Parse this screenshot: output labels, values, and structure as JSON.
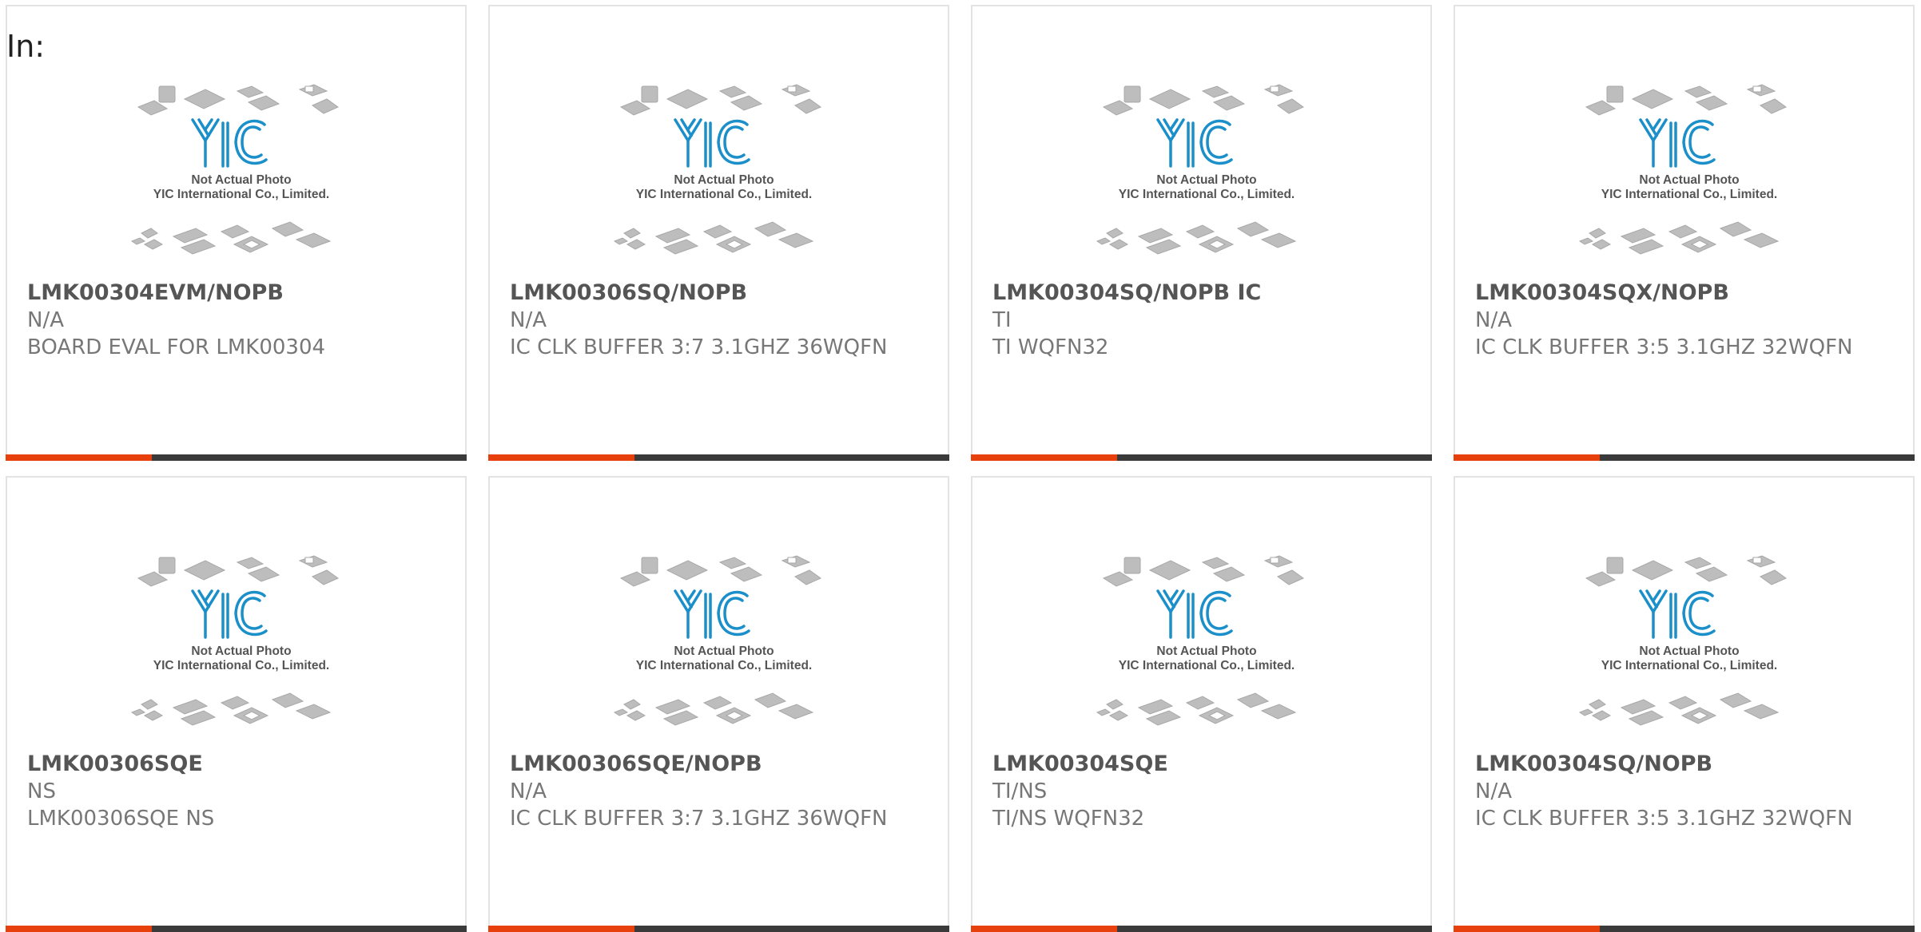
{
  "header": {
    "in_label": "In:"
  },
  "placeholder": {
    "logo_text": "YIC",
    "line1": "Not Actual Photo",
    "line2": "YIC International Co., Limited."
  },
  "colors": {
    "accent": "#e8400c",
    "bar": "#3a3a3a",
    "logo": "#1a8fc9"
  },
  "products": [
    {
      "part_number": "LMK00304EVM/NOPB",
      "manufacturer": "N/A",
      "description": "BOARD EVAL FOR LMK00304"
    },
    {
      "part_number": "LMK00306SQ/NOPB",
      "manufacturer": "N/A",
      "description": "IC CLK BUFFER 3:7 3.1GHZ 36WQFN"
    },
    {
      "part_number": "LMK00304SQ/NOPB IC",
      "manufacturer": "TI",
      "description": "TI WQFN32"
    },
    {
      "part_number": "LMK00304SQX/NOPB",
      "manufacturer": "N/A",
      "description": "IC CLK BUFFER 3:5 3.1GHZ 32WQFN"
    },
    {
      "part_number": "LMK00306SQE",
      "manufacturer": "NS",
      "description": "LMK00306SQE NS"
    },
    {
      "part_number": "LMK00306SQE/NOPB",
      "manufacturer": "N/A",
      "description": "IC CLK BUFFER 3:7 3.1GHZ 36WQFN"
    },
    {
      "part_number": "LMK00304SQE",
      "manufacturer": "TI/NS",
      "description": "TI/NS WQFN32"
    },
    {
      "part_number": "LMK00304SQ/NOPB",
      "manufacturer": "N/A",
      "description": "IC CLK BUFFER 3:5 3.1GHZ 32WQFN"
    }
  ]
}
